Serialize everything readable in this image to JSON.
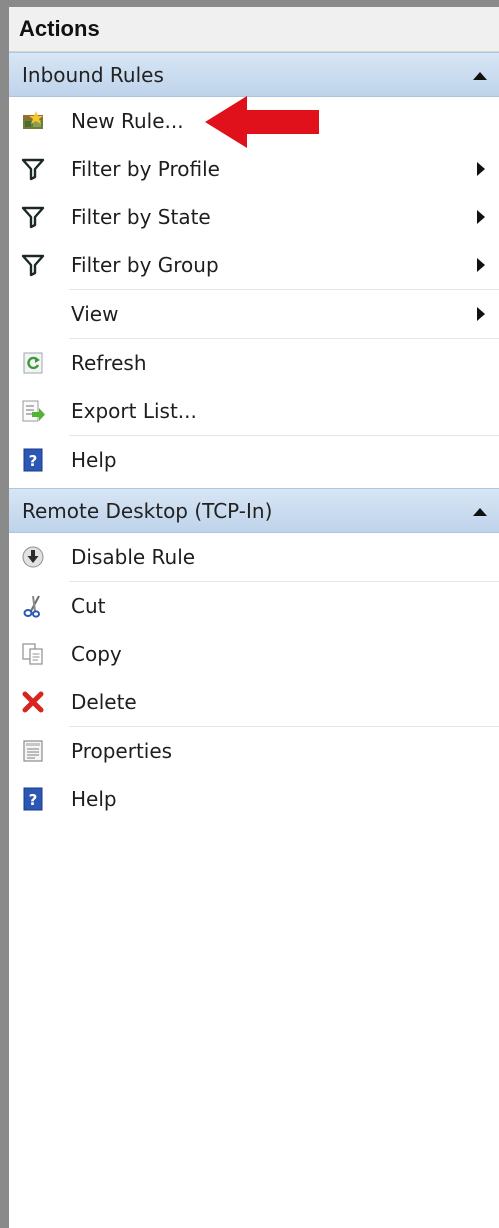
{
  "pane": {
    "title": "Actions"
  },
  "sections": [
    {
      "header": "Inbound Rules",
      "items": [
        {
          "label": "New Rule...",
          "icon": "new-rule-icon"
        },
        {
          "label": "Filter by Profile",
          "icon": "filter-icon",
          "submenu": true
        },
        {
          "label": "Filter by State",
          "icon": "filter-icon",
          "submenu": true
        },
        {
          "label": "Filter by Group",
          "icon": "filter-icon",
          "submenu": true
        },
        {
          "label": "View",
          "icon": "",
          "submenu": true
        },
        {
          "label": "Refresh",
          "icon": "refresh-icon"
        },
        {
          "label": "Export List...",
          "icon": "export-list-icon"
        },
        {
          "label": "Help",
          "icon": "help-icon"
        }
      ]
    },
    {
      "header": "Remote Desktop (TCP-In)",
      "items": [
        {
          "label": "Disable Rule",
          "icon": "disable-rule-icon"
        },
        {
          "label": "Cut",
          "icon": "cut-scissors-icon"
        },
        {
          "label": "Copy",
          "icon": "copy-icon"
        },
        {
          "label": "Delete",
          "icon": "delete-x-icon"
        },
        {
          "label": "Properties",
          "icon": "properties-icon"
        },
        {
          "label": "Help",
          "icon": "help-icon"
        }
      ]
    }
  ],
  "colors": {
    "section_header_top": "#d8e6f5",
    "section_header_bottom": "#bed3ea",
    "annotation_arrow": "#e0111b",
    "help_icon_blue": "#2d57b4",
    "delete_red": "#d8251d",
    "filter_dark": "#1a2a22"
  }
}
